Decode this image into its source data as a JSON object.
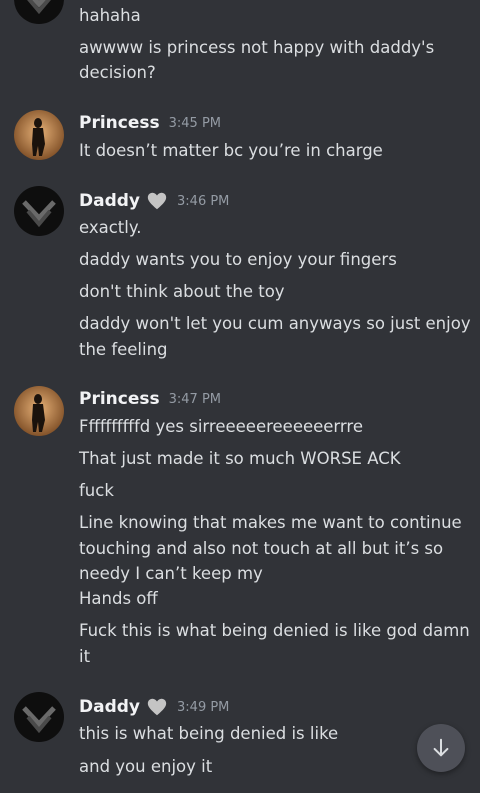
{
  "messages": {
    "top": {
      "lines": [
        "hahaha",
        "awwww is princess not happy with daddy's",
        "decision?"
      ]
    },
    "m1": {
      "author": "Princess",
      "time": "3:45 PM",
      "lines": [
        "It doesn’t matter bc you’re in charge"
      ]
    },
    "m2": {
      "author": "Daddy",
      "time": "3:46 PM",
      "lines": [
        "exactly.",
        "daddy wants you to enjoy your fingers",
        "don't think about the toy",
        "daddy won't let you cum anyways so just enjoy",
        "the feeling"
      ]
    },
    "m3": {
      "author": "Princess",
      "time": "3:47 PM",
      "lines": [
        "Ffffffffffd yes sirreeeeereeeeeerrre",
        "That just made it so much WORSE ACK",
        "fuck",
        "Line knowing that makes me want to continue",
        "touching and also not touch at all but it’s so",
        "needy I can’t keep my",
        "Hands off",
        "Fuck this is what being denied is like god damn",
        "it"
      ]
    },
    "m4": {
      "author": "Daddy",
      "time": "3:49 PM",
      "lines": [
        "this is what being denied is like",
        "and you enjoy it"
      ]
    }
  },
  "icons": {
    "heart": "grey-heart-icon",
    "scroll": "arrow-down-icon"
  },
  "colors": {
    "background": "#313338",
    "text": "#dbdee1",
    "author": "#f2f3f5",
    "timestamp": "#949ba4",
    "scroll_button": "#4e5058"
  }
}
